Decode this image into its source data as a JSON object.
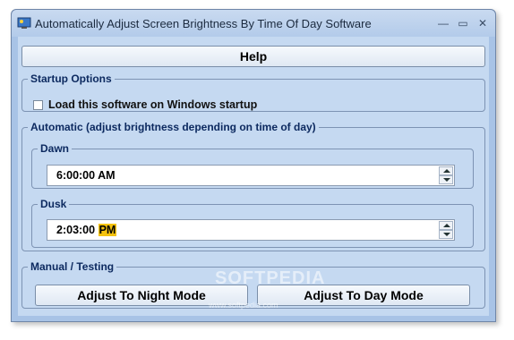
{
  "window": {
    "title": "Automatically Adjust Screen Brightness By Time Of Day Software",
    "min_label": "—",
    "max_label": "▭",
    "close_label": "✕"
  },
  "help_button": "Help",
  "startup": {
    "legend": "Startup Options",
    "checkbox_label": "Load this software on Windows startup",
    "checked": false
  },
  "automatic": {
    "legend": "Automatic (adjust brightness depending on time of day)",
    "dawn": {
      "legend": "Dawn",
      "time": "6:00:00 AM"
    },
    "dusk": {
      "legend": "Dusk",
      "time_main": "2:03:00",
      "time_ampm": "PM"
    }
  },
  "manual": {
    "legend": "Manual / Testing",
    "night_button": "Adjust To Night Mode",
    "day_button": "Adjust To Day Mode"
  },
  "watermark": {
    "brand": "SOFTPEDIA",
    "url": "www.softpedia.com"
  },
  "colors": {
    "accent_highlight": "#f4c20d",
    "client_bg": "#c5d9f1"
  }
}
